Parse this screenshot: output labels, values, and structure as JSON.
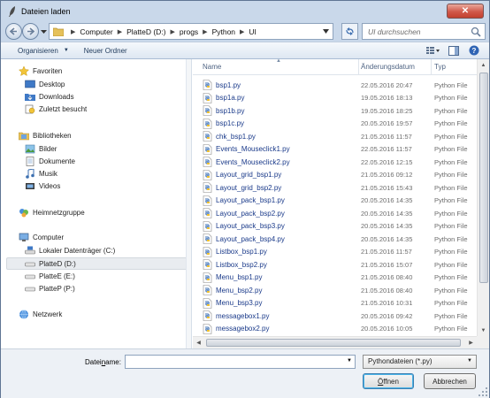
{
  "window": {
    "title": "Dateien laden",
    "close_label": "✕"
  },
  "address": {
    "crumbs": [
      "Computer",
      "PlatteD (D:)",
      "progs",
      "Python",
      "UI"
    ],
    "search_placeholder": "UI durchsuchen"
  },
  "toolbar": {
    "organize_label": "Organisieren",
    "new_folder_label": "Neuer Ordner"
  },
  "nav": {
    "favorites": "Favoriten",
    "desktop": "Desktop",
    "downloads": "Downloads",
    "recent": "Zuletzt besucht",
    "libraries": "Bibliotheken",
    "pictures": "Bilder",
    "documents": "Dokumente",
    "music": "Musik",
    "videos": "Videos",
    "homegroup": "Heimnetzgruppe",
    "computer": "Computer",
    "drive_c": "Lokaler Datenträger (C:)",
    "drive_d": "PlatteD (D:)",
    "drive_e": "PlatteE (E:)",
    "drive_p": "PlatteP (P:)",
    "network": "Netzwerk"
  },
  "columns": {
    "name": "Name",
    "date": "Änderungsdatum",
    "type": "Typ"
  },
  "files": [
    {
      "name": "bsp1.py",
      "date": "22.05.2016 20:47",
      "type": "Python File"
    },
    {
      "name": "bsp1a.py",
      "date": "19.05.2016 18:13",
      "type": "Python File"
    },
    {
      "name": "bsp1b.py",
      "date": "19.05.2016 18:25",
      "type": "Python File"
    },
    {
      "name": "bsp1c.py",
      "date": "20.05.2016 19:57",
      "type": "Python File"
    },
    {
      "name": "chk_bsp1.py",
      "date": "21.05.2016 11:57",
      "type": "Python File"
    },
    {
      "name": "Events_Mouseclick1.py",
      "date": "22.05.2016 11:57",
      "type": "Python File"
    },
    {
      "name": "Events_Mouseclick2.py",
      "date": "22.05.2016 12:15",
      "type": "Python File"
    },
    {
      "name": "Layout_grid_bsp1.py",
      "date": "21.05.2016 09:12",
      "type": "Python File"
    },
    {
      "name": "Layout_grid_bsp2.py",
      "date": "21.05.2016 15:43",
      "type": "Python File"
    },
    {
      "name": "Layout_pack_bsp1.py",
      "date": "20.05.2016 14:35",
      "type": "Python File"
    },
    {
      "name": "Layout_pack_bsp2.py",
      "date": "20.05.2016 14:35",
      "type": "Python File"
    },
    {
      "name": "Layout_pack_bsp3.py",
      "date": "20.05.2016 14:35",
      "type": "Python File"
    },
    {
      "name": "Layout_pack_bsp4.py",
      "date": "20.05.2016 14:35",
      "type": "Python File"
    },
    {
      "name": "Listbox_bsp1.py",
      "date": "21.05.2016 11:57",
      "type": "Python File"
    },
    {
      "name": "Listbox_bsp2.py",
      "date": "21.05.2016 15:07",
      "type": "Python File"
    },
    {
      "name": "Menu_bsp1.py",
      "date": "21.05.2016 08:40",
      "type": "Python File"
    },
    {
      "name": "Menu_bsp2.py",
      "date": "21.05.2016 08:40",
      "type": "Python File"
    },
    {
      "name": "Menu_bsp3.py",
      "date": "21.05.2016 10:31",
      "type": "Python File"
    },
    {
      "name": "messagebox1.py",
      "date": "20.05.2016 09:42",
      "type": "Python File"
    },
    {
      "name": "messagebox2.py",
      "date": "20.05.2016 10:05",
      "type": "Python File"
    }
  ],
  "bottom": {
    "filename_label_pre": "Datei",
    "filename_label_u": "n",
    "filename_label_post": "ame:",
    "filename_value": "",
    "filetype_value": "Pythondateien (*.py)",
    "open_label_u": "Ö",
    "open_label_rest": "ffnen",
    "cancel_label": "Abbrechen"
  }
}
